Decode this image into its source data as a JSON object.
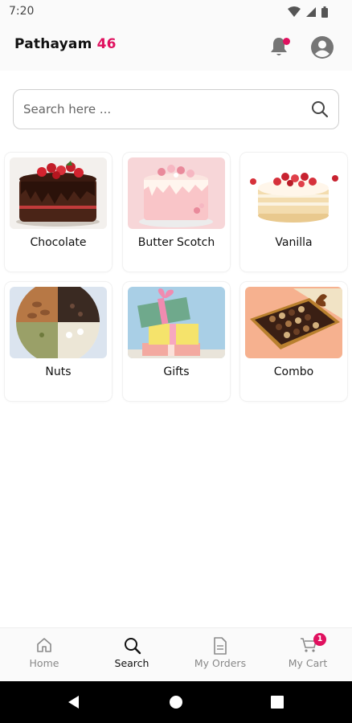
{
  "status_bar": {
    "time": "7:20"
  },
  "app": {
    "title_main": "Pathayam",
    "title_accent": "46",
    "accent_color": "#e0115f"
  },
  "search": {
    "placeholder": "Search here ..."
  },
  "categories": [
    {
      "label": "Chocolate",
      "image": "chocolate-cake"
    },
    {
      "label": "Butter Scotch",
      "image": "butterscotch-cake"
    },
    {
      "label": "Vanilla",
      "image": "vanilla-cake"
    },
    {
      "label": "Nuts",
      "image": "nuts-bowl"
    },
    {
      "label": "Gifts",
      "image": "gift-boxes"
    },
    {
      "label": "Combo",
      "image": "chocolate-box"
    }
  ],
  "bottom_nav": {
    "items": [
      {
        "label": "Home",
        "icon": "home-icon"
      },
      {
        "label": "Search",
        "icon": "search-icon",
        "active": true
      },
      {
        "label": "My Orders",
        "icon": "orders-icon"
      },
      {
        "label": "My Cart",
        "icon": "cart-icon"
      }
    ],
    "cart_badge": "1"
  }
}
